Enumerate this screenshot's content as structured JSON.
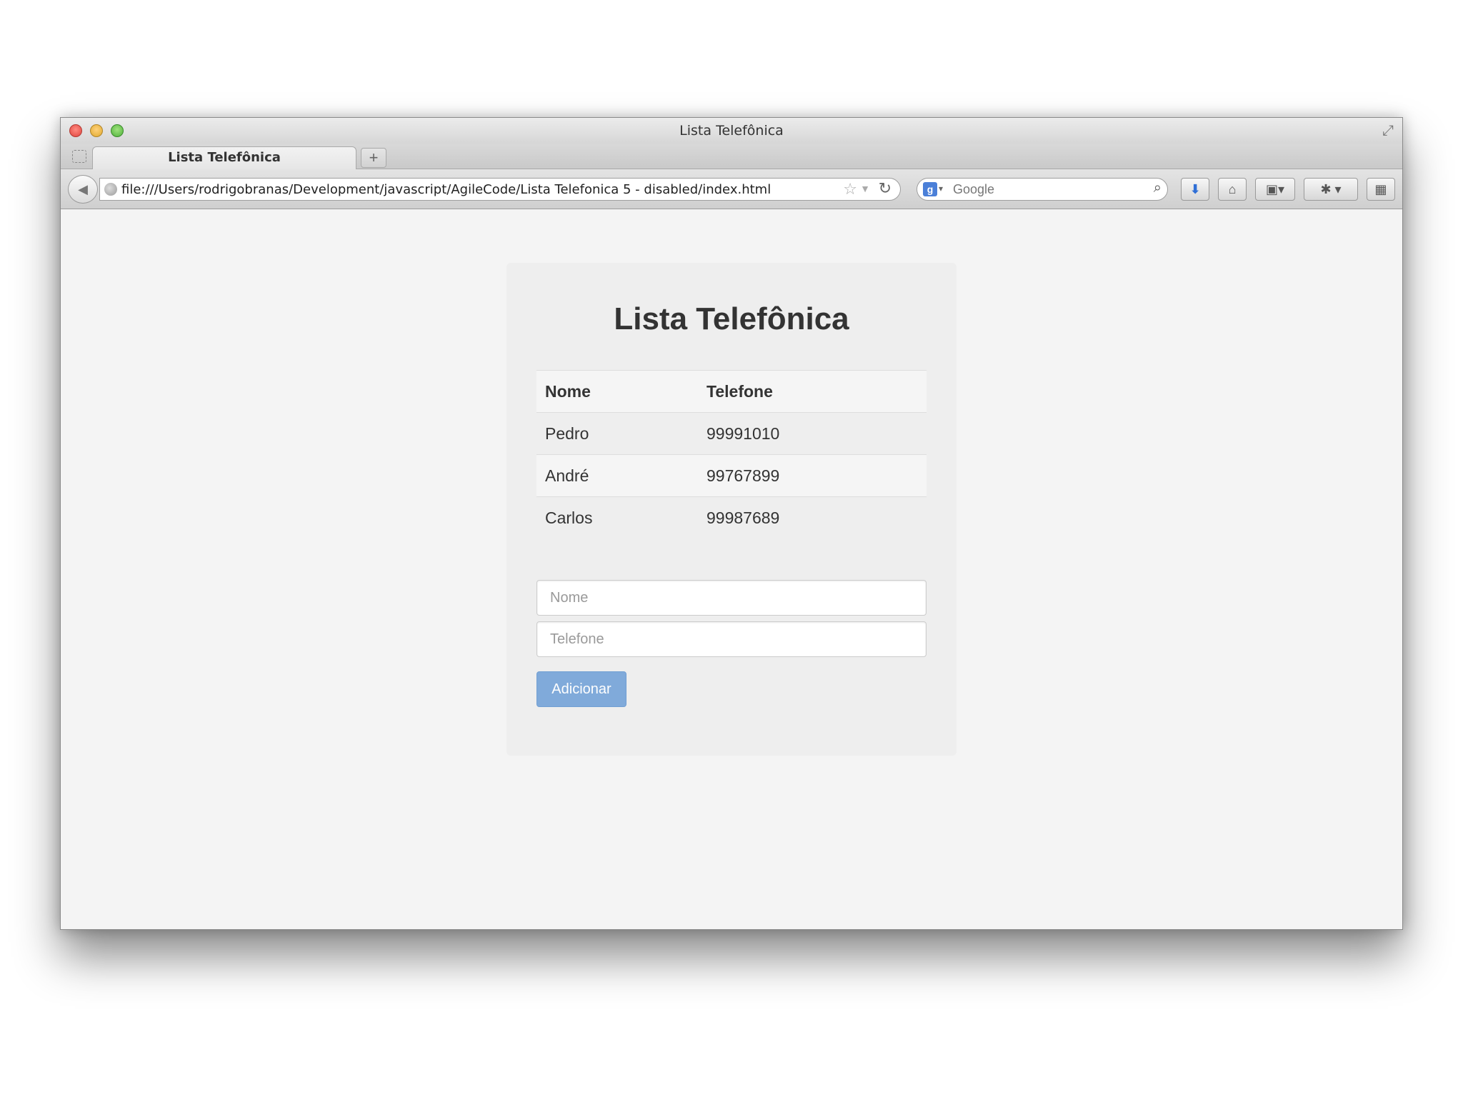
{
  "window": {
    "title": "Lista Telefônica"
  },
  "tabs": [
    {
      "label": "Lista Telefônica"
    }
  ],
  "toolbar": {
    "new_tab_label": "+",
    "url": "file:///Users/rodrigobranas/Development/javascript/AgileCode/Lista Telefonica 5 - disabled/index.html",
    "search_placeholder": "Google"
  },
  "icons": {
    "back": "back-arrow-icon",
    "globe": "globe-icon",
    "star": "star-icon",
    "reload": "reload-icon",
    "search_engine": "google-icon",
    "search": "search-icon",
    "download": "download-icon",
    "home": "home-icon",
    "bookmarks": "bookmarks-icon",
    "addons": "addons-icon",
    "tabview": "tab-view-icon",
    "fullscreen": "fullscreen-icon"
  },
  "page": {
    "title": "Lista Telefônica",
    "table": {
      "headers": [
        "Nome",
        "Telefone"
      ],
      "rows": [
        [
          "Pedro",
          "99991010"
        ],
        [
          "André",
          "99767899"
        ],
        [
          "Carlos",
          "99987689"
        ]
      ]
    },
    "form": {
      "nome_placeholder": "Nome",
      "telefone_placeholder": "Telefone",
      "submit_label": "Adicionar"
    }
  },
  "colors": {
    "button_bg": "#7ba7d9",
    "page_bg": "#f4f4f4",
    "card_bg": "#eeeeee"
  }
}
